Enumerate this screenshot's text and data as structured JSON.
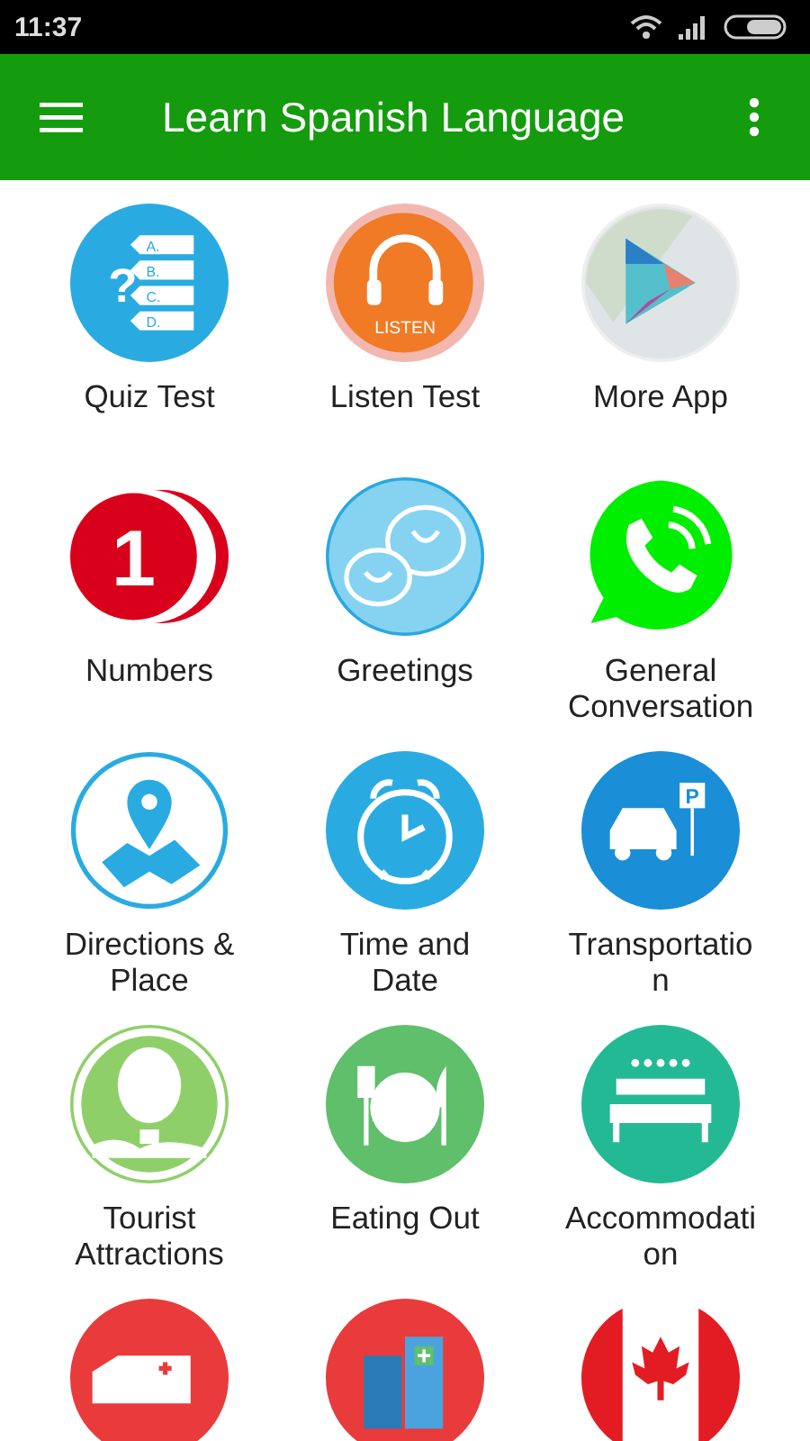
{
  "status_bar": {
    "time": "11:37"
  },
  "app_bar": {
    "title": "Learn Spanish Language"
  },
  "tiles": [
    {
      "kind": "quiz",
      "label": "Quiz Test",
      "icon_text": [
        "?",
        "A.",
        "B.",
        "C.",
        "D."
      ]
    },
    {
      "kind": "listen",
      "label": "Listen Test",
      "icon_text": [
        "LISTEN"
      ]
    },
    {
      "kind": "store",
      "label": "More App"
    },
    {
      "kind": "numbers",
      "label": "Numbers",
      "icon_text": [
        "1"
      ]
    },
    {
      "kind": "greetings",
      "label": "Greetings"
    },
    {
      "kind": "phone",
      "label": "General Conversation"
    },
    {
      "kind": "directions",
      "label": "Directions & Place"
    },
    {
      "kind": "clock",
      "label": "Time and Date"
    },
    {
      "kind": "transport",
      "label": "Transportation",
      "icon_text": [
        "P"
      ]
    },
    {
      "kind": "balloon",
      "label": "Tourist Attractions"
    },
    {
      "kind": "dining",
      "label": "Eating Out"
    },
    {
      "kind": "hotel",
      "label": "Accommodation"
    },
    {
      "kind": "ambulance"
    },
    {
      "kind": "hospital"
    },
    {
      "kind": "flag"
    }
  ]
}
